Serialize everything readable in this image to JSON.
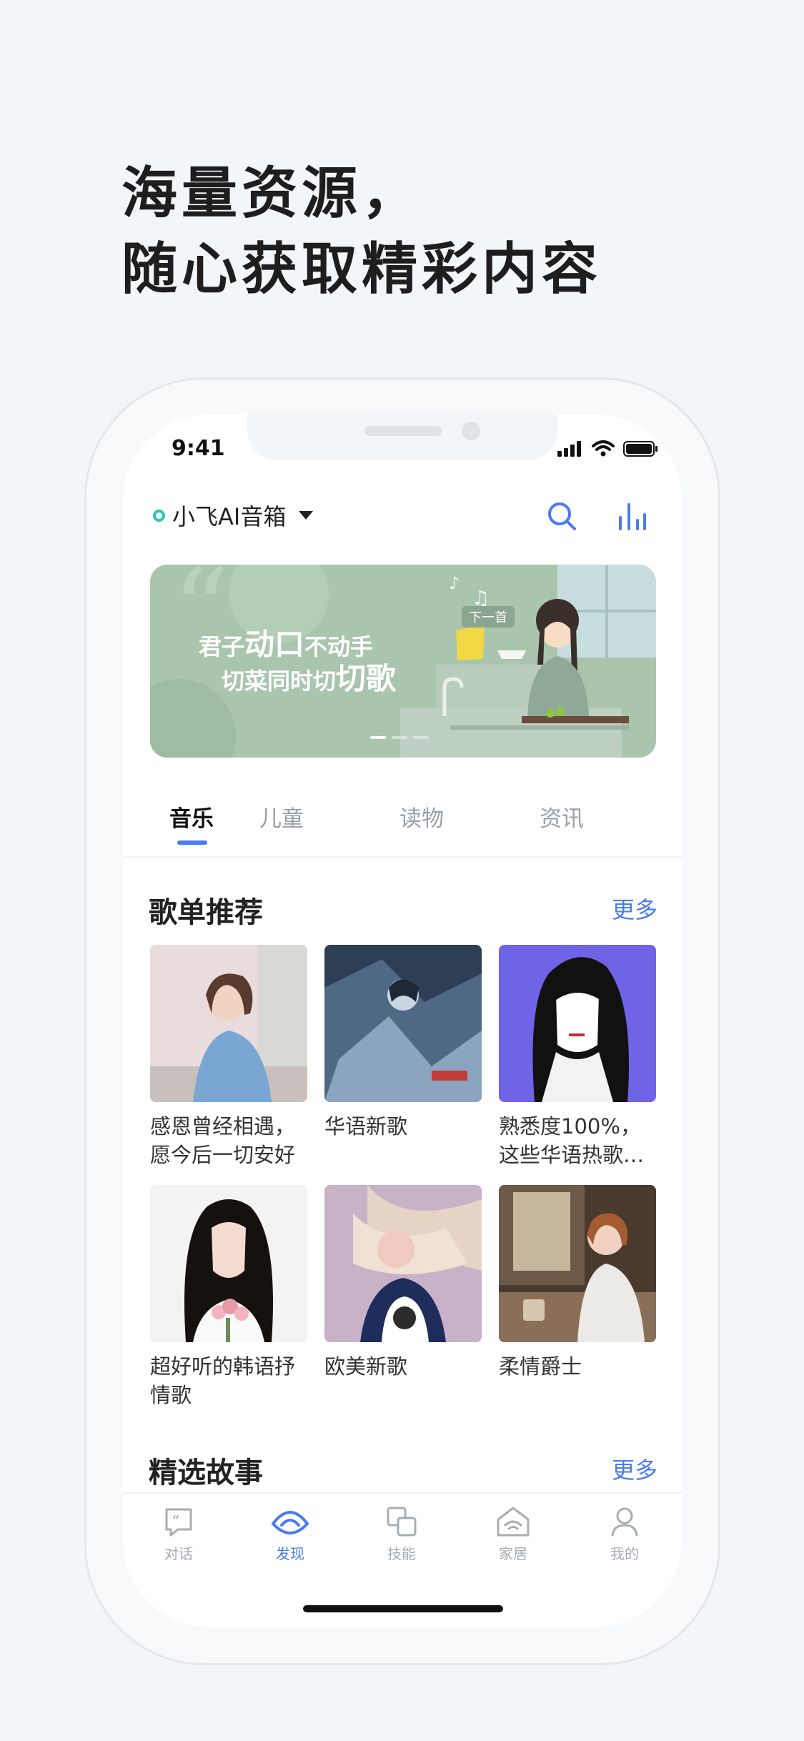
{
  "headline": {
    "line1": "海量资源，",
    "line2": "随心获取精彩内容"
  },
  "status_bar": {
    "time": "9:41"
  },
  "header": {
    "device_name": "小飞AI音箱",
    "icons": [
      "search-icon",
      "equalizer-icon"
    ]
  },
  "banner": {
    "line1_a": "君子",
    "line1_b": "动口",
    "line1_c": "不动手",
    "line2_a": "切菜同时切",
    "line2_b": "切歌",
    "next_tag": "下一首",
    "page_count": 3,
    "active_page": 1
  },
  "tabs": [
    {
      "label": "音乐",
      "active": true
    },
    {
      "label": "儿童",
      "active": false
    },
    {
      "label": "读物",
      "active": false
    },
    {
      "label": "资讯",
      "active": false
    }
  ],
  "playlist_section": {
    "title": "歌单推荐",
    "more": "更多",
    "items": [
      {
        "title": "感恩曾经相遇，愿今后一切安好"
      },
      {
        "title": "华语新歌"
      },
      {
        "title": "熟悉度100%，这些华语热歌…"
      },
      {
        "title": "超好听的韩语抒情歌"
      },
      {
        "title": "欧美新歌"
      },
      {
        "title": "柔情爵士"
      }
    ]
  },
  "story_section": {
    "title": "精选故事",
    "more": "更多"
  },
  "bottom_nav": [
    {
      "label": "对话",
      "icon": "chat-quote-icon",
      "active": false
    },
    {
      "label": "发现",
      "icon": "discover-icon",
      "active": true
    },
    {
      "label": "技能",
      "icon": "skills-icon",
      "active": false
    },
    {
      "label": "家居",
      "icon": "home-icon",
      "active": false
    },
    {
      "label": "我的",
      "icon": "profile-icon",
      "active": false
    }
  ],
  "colors": {
    "accent": "#4a7bf0",
    "device_dot": "#2ec4b6",
    "banner_bg": "#a9c5ad",
    "page_bg": "#f3f6f9"
  }
}
